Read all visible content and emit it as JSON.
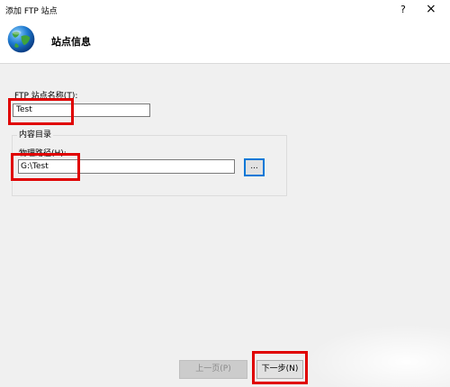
{
  "window": {
    "title": "添加 FTP 站点",
    "help_label": "?",
    "close_label": "×"
  },
  "header": {
    "title": "站点信息",
    "icon": "globe-icon"
  },
  "site_name": {
    "label": "FTP 站点名称(T):",
    "value": "Test"
  },
  "content_directory": {
    "legend": "内容目录",
    "path_label": "物理路径(H):",
    "path_value": "G:\\Test",
    "browse_label": "..."
  },
  "buttons": {
    "prev_label": "上一页(P)",
    "next_label": "下一步(N)"
  },
  "colors": {
    "annotation_red": "#e00000",
    "focus_blue": "#0078d7"
  }
}
